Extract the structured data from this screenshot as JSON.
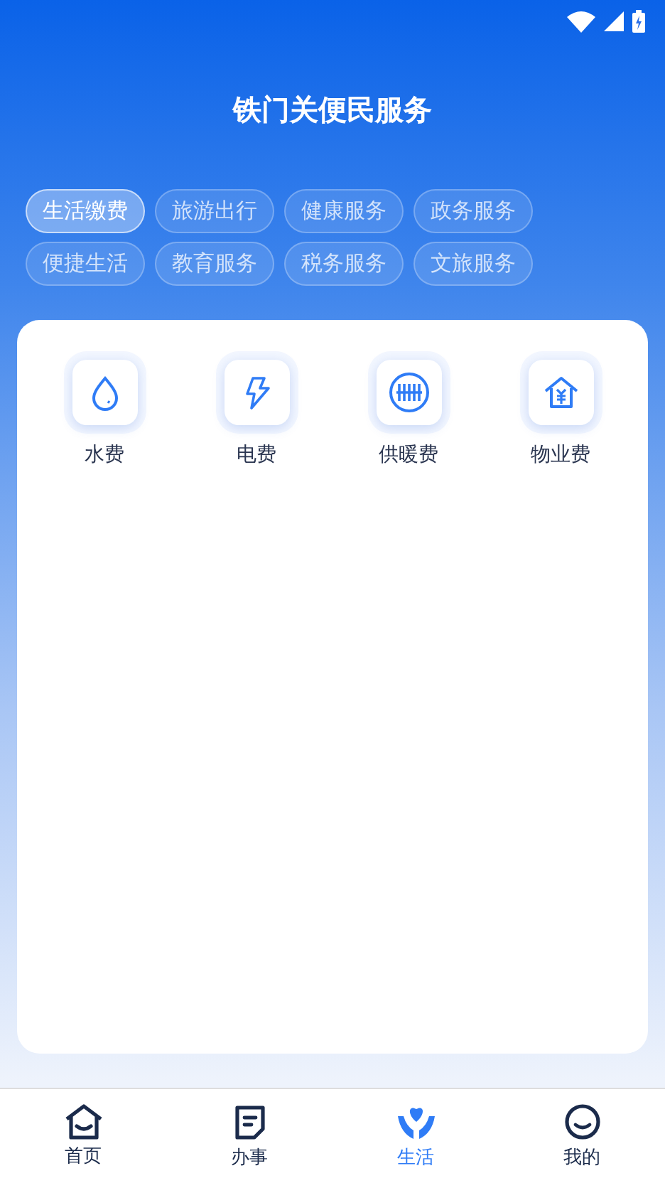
{
  "title": "铁门关便民服务",
  "categories": [
    {
      "label": "生活缴费",
      "selected": true
    },
    {
      "label": "旅游出行",
      "selected": false
    },
    {
      "label": "健康服务",
      "selected": false
    },
    {
      "label": "政务服务",
      "selected": false
    },
    {
      "label": "便捷生活",
      "selected": false
    },
    {
      "label": "教育服务",
      "selected": false
    },
    {
      "label": "税务服务",
      "selected": false
    },
    {
      "label": "文旅服务",
      "selected": false
    }
  ],
  "services": [
    {
      "kind": "water",
      "label": "水费"
    },
    {
      "kind": "power",
      "label": "电费"
    },
    {
      "kind": "heating",
      "label": "供暖费"
    },
    {
      "kind": "property",
      "label": "物业费"
    }
  ],
  "nav": [
    {
      "kind": "home",
      "label": "首页",
      "selected": false
    },
    {
      "kind": "tasks",
      "label": "办事",
      "selected": false
    },
    {
      "kind": "life",
      "label": "生活",
      "selected": true
    },
    {
      "kind": "me",
      "label": "我的",
      "selected": false
    }
  ]
}
